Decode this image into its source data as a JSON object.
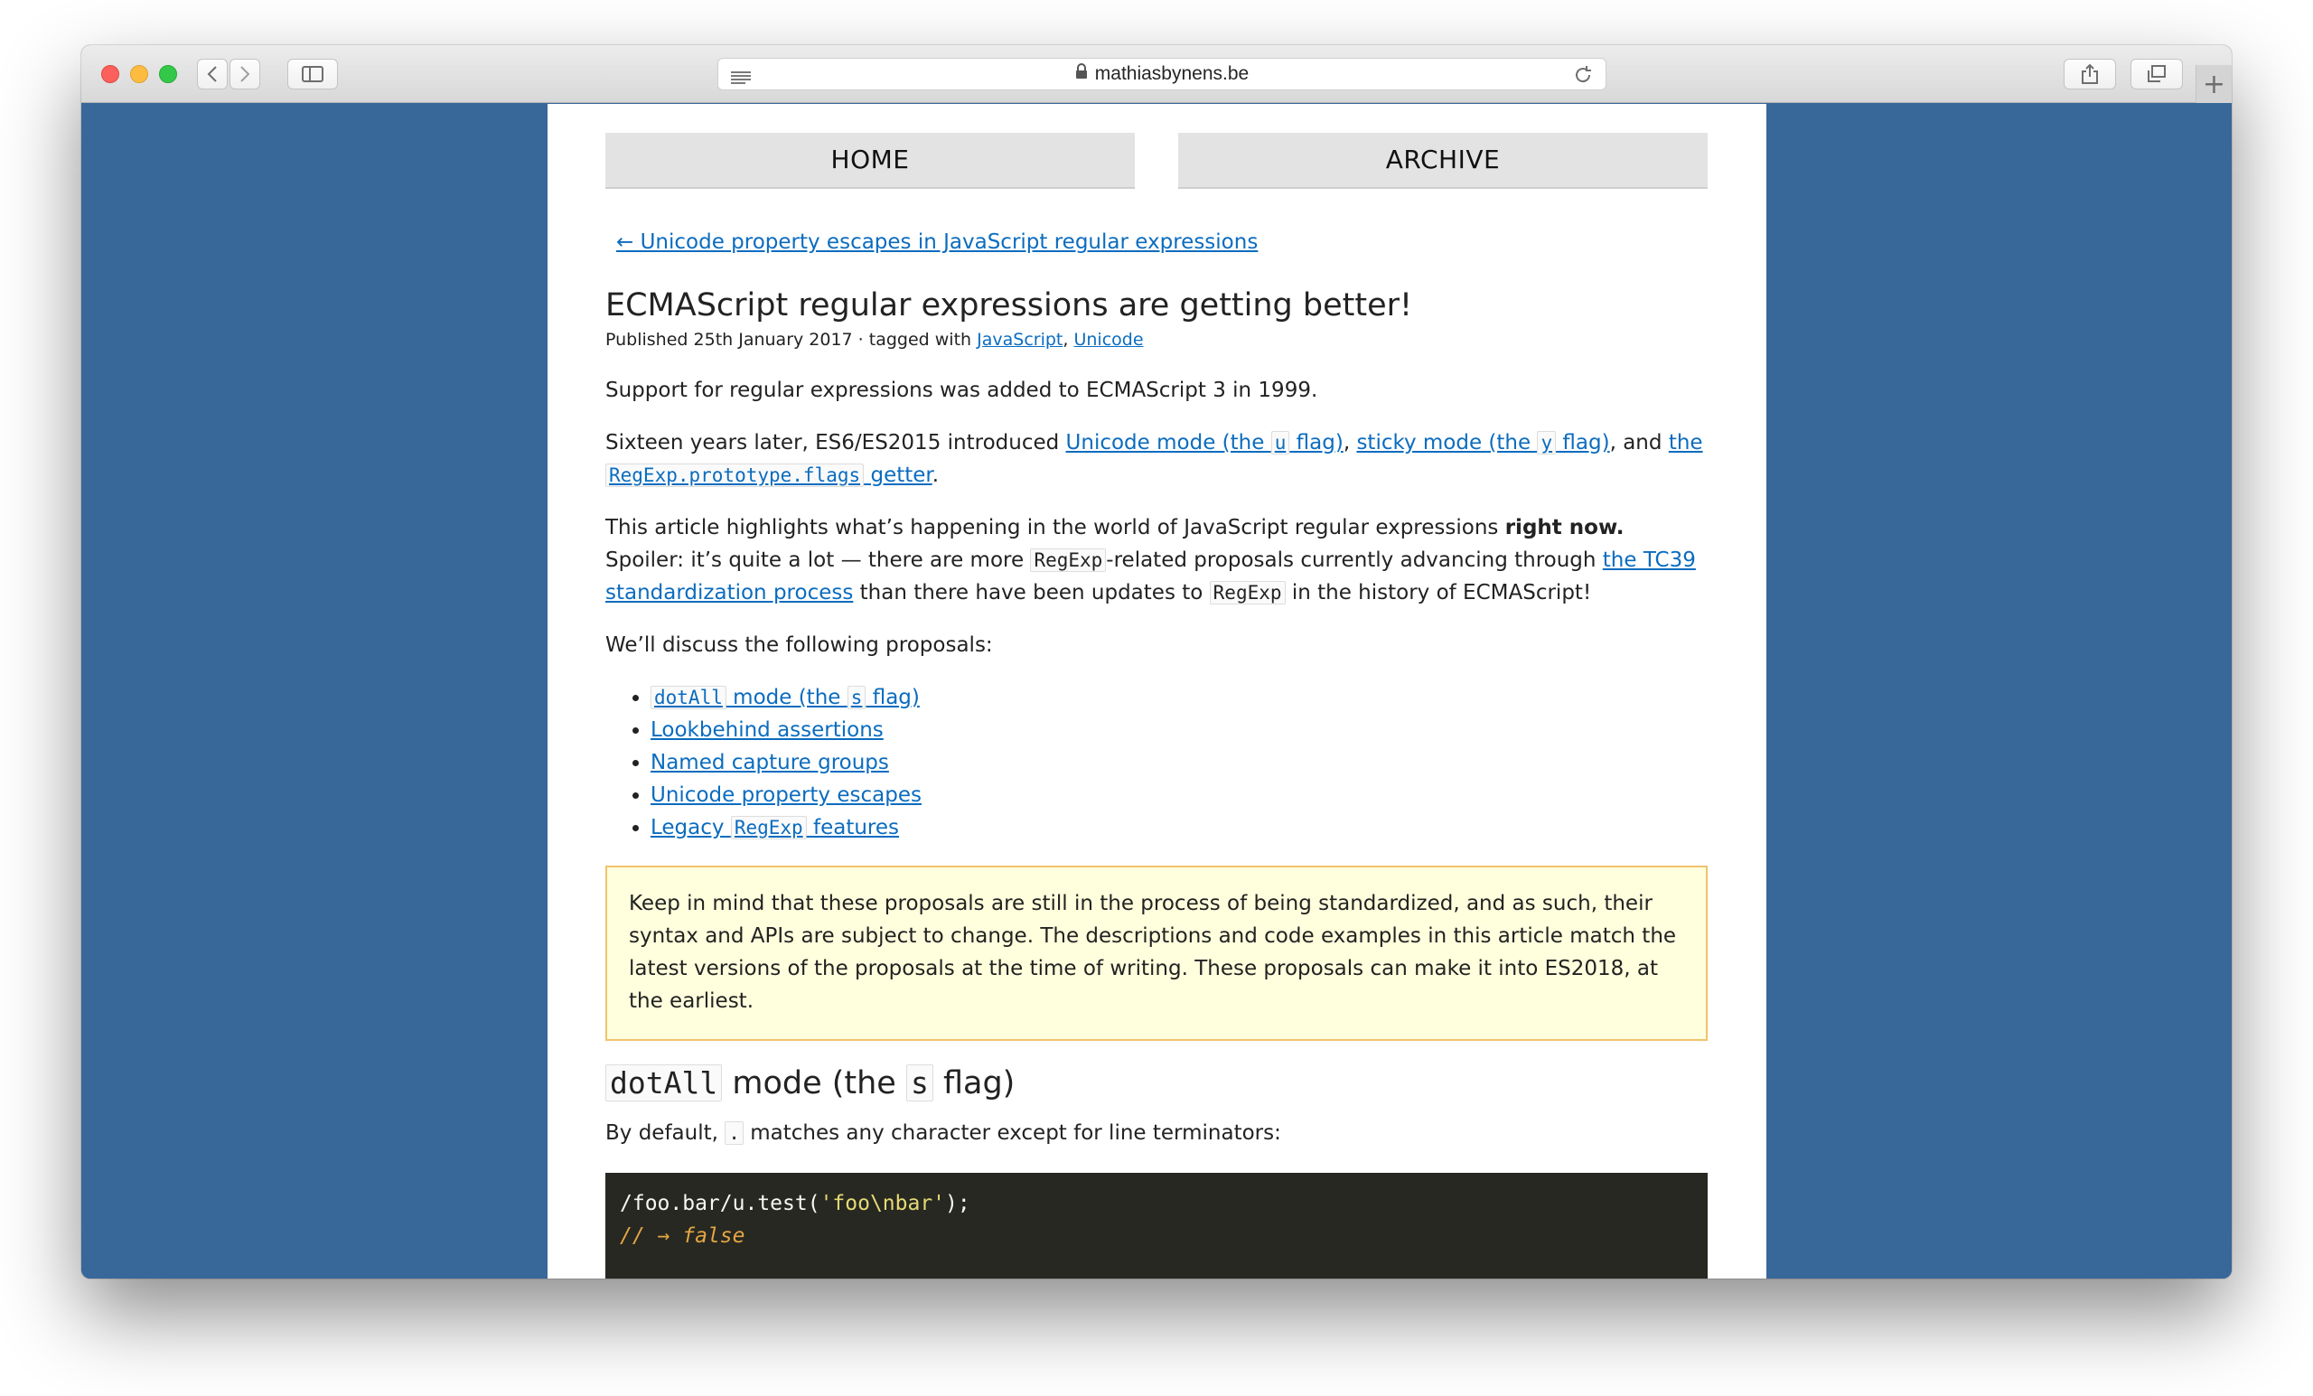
{
  "browser": {
    "url": "mathiasbynens.be",
    "new_tab_label": "+"
  },
  "nav": {
    "home": "HOME",
    "archive": "ARCHIVE"
  },
  "article": {
    "prev_link": "← Unicode property escapes in JavaScript regular expressions",
    "title": "ECMAScript regular expressions are getting better!",
    "meta_prefix": "Published 25th January 2017 · tagged with ",
    "tag_1": "JavaScript",
    "tag_sep": ",",
    "tag_2": "Unicode",
    "p1": "Support for regular expressions was added to ECMAScript 3 in 1999.",
    "p2": {
      "t1": "Sixteen years later, ES6/ES2015 introduced ",
      "l1a": "Unicode mode (the ",
      "l1code": "u",
      "l1b": " flag)",
      "t2": ", ",
      "l2a": "sticky mode (the ",
      "l2code": "y",
      "l2b": " flag)",
      "t3": ", and ",
      "l3a": "the",
      "l3code": "RegExp.prototype.flags",
      "l3b": " getter",
      "t4": "."
    },
    "p3": {
      "t1": "This article highlights what’s happening in the world of JavaScript regular expressions ",
      "bold": "right now.",
      "t2": " Spoiler: it’s quite a lot — there are more ",
      "code1": "RegExp",
      "t3": "-related proposals currently advancing through ",
      "link": "the TC39 standardization process",
      "t4": " than there have been updates to ",
      "code2": "RegExp",
      "t5": " in the history of ECMAScript!"
    },
    "p4": "We’ll discuss the following proposals:",
    "list": {
      "i1code": "dotAll",
      "i1a": " mode (the ",
      "i1code2": "s",
      "i1b": " flag)",
      "i2": "Lookbehind assertions",
      "i3": "Named capture groups",
      "i4": "Unicode property escapes",
      "i5a": "Legacy ",
      "i5code": "RegExp",
      "i5b": " features"
    },
    "note": "Keep in mind that these proposals are still in the process of being standardized, and as such, their syntax and APIs are subject to change. The descriptions and code examples in this article match the latest versions of the proposals at the time of writing. These proposals can make it into ES2018, at the earliest.",
    "h2": {
      "code1": "dotAll",
      "t1": " mode (the ",
      "code2": "s",
      "t2": " flag)"
    },
    "p5": {
      "t1": "By default, ",
      "code": ".",
      "t2": " matches any character except for line terminators:"
    },
    "code_block": {
      "line1_a": "/foo.bar/u.test(",
      "line1_str": "'foo\\nbar'",
      "line1_b": ");",
      "line2": "// → false"
    }
  },
  "colors": {
    "background": "#386799",
    "link": "#0b6cbf",
    "note_bg": "#ffffdd",
    "note_border": "#f0c36d",
    "code_bg": "#272822"
  }
}
